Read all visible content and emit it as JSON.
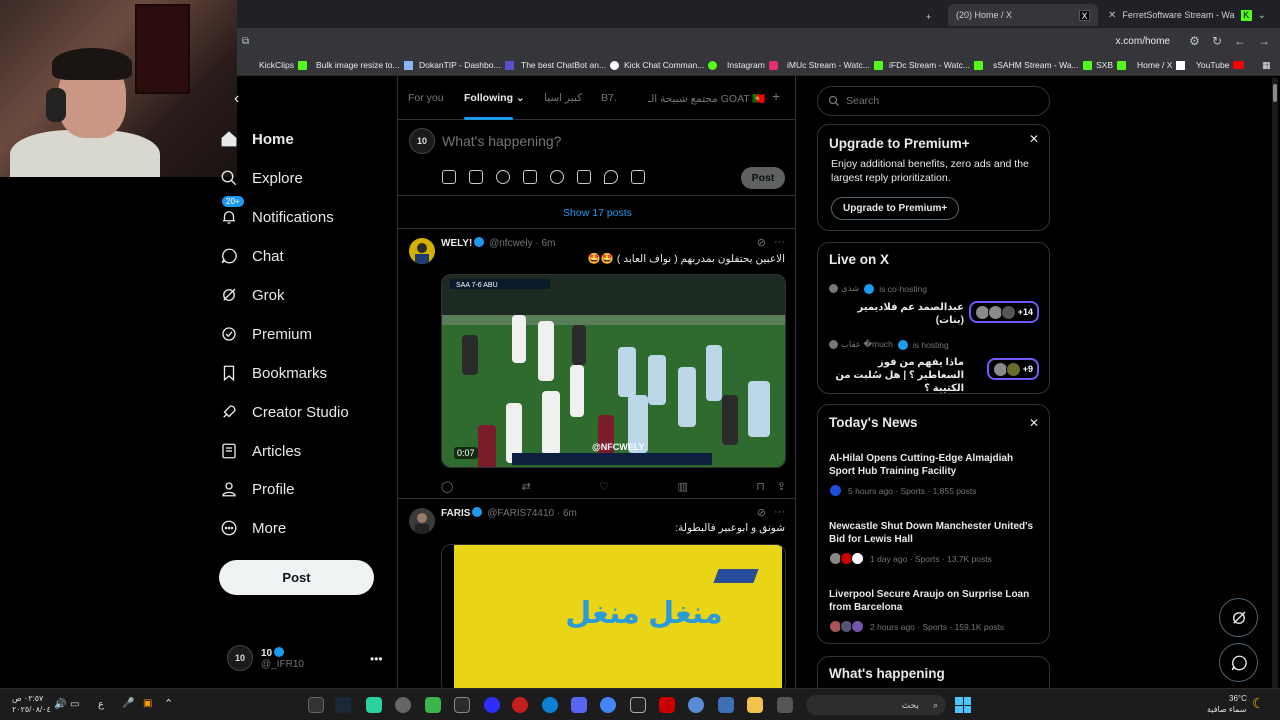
{
  "browser": {
    "tabs": [
      {
        "label": "(20) Home / X",
        "favicon": "X"
      },
      {
        "label": "FerretSoftware Stream - Wa",
        "favicon": "K"
      }
    ],
    "url": "x.com/home",
    "bookmarks": [
      {
        "label": "KickClips",
        "icon": "kick"
      },
      {
        "label": "Bulk image resize to...",
        "icon": "doc"
      },
      {
        "label": "DokanTIP - Dashbo...",
        "icon": "doc"
      },
      {
        "label": "The best ChatBot an...",
        "icon": "doc"
      },
      {
        "label": "Kick Chat Comman...",
        "icon": "doc"
      },
      {
        "label": "Instagram",
        "icon": "instagram"
      },
      {
        "label": "iMUc Stream - Watc...",
        "icon": "kick"
      },
      {
        "label": "iFDc Stream - Watc...",
        "icon": "kick"
      },
      {
        "label": "sSAHM Stream - Wa...",
        "icon": "kick"
      },
      {
        "label": "SXB",
        "icon": "kick"
      },
      {
        "label": "Home / X",
        "icon": "x"
      },
      {
        "label": "YouTube",
        "icon": "youtube"
      }
    ]
  },
  "nav": {
    "items": [
      {
        "label": "Home",
        "icon": "home-icon"
      },
      {
        "label": "Explore",
        "icon": "search-icon"
      },
      {
        "label": "Notifications",
        "icon": "bell-icon",
        "badge": "20+"
      },
      {
        "label": "Chat",
        "icon": "chat-icon"
      },
      {
        "label": "Grok",
        "icon": "grok-icon"
      },
      {
        "label": "Premium",
        "icon": "premium-icon"
      },
      {
        "label": "Bookmarks",
        "icon": "bookmark-icon"
      },
      {
        "label": "Creator Studio",
        "icon": "rocket-icon"
      },
      {
        "label": "Articles",
        "icon": "article-icon"
      },
      {
        "label": "Profile",
        "icon": "profile-icon"
      },
      {
        "label": "More",
        "icon": "more-icon"
      }
    ],
    "post_label": "Post",
    "account": {
      "name": "10",
      "handle": "@_IFR10",
      "avatar_text": "10"
    }
  },
  "feed": {
    "tabs": [
      "For you",
      "Following",
      "كبير اسيا",
      "B7.",
      "مجتمع شبيحة الـ GOAT 🇵🇹"
    ],
    "active_tab": "Following",
    "composer_placeholder": "What's happening?",
    "composer_post": "Post",
    "show_posts": "Show 17 posts",
    "tweets": [
      {
        "name": "WELY!",
        "handle": "@nfcwely",
        "time": "6m",
        "text": "الاعبين يحتفلون بمدربهم ( نواف العابد ) 🤩🤩",
        "video_time": "0:07",
        "scoreboard": "SAA 7-6 ABU",
        "watermark": "@NFCWELY"
      },
      {
        "name": "FARIS",
        "handle": "@FARIS74410",
        "time": "6m",
        "text": "شونق و ابوعبير فالبطولة:",
        "media_text": "منغل منغل"
      }
    ]
  },
  "sidebar": {
    "search_placeholder": "Search",
    "premium": {
      "title": "Upgrade to Premium+",
      "desc": "Enjoy additional benefits, zero ads and the largest reply prioritization.",
      "button": "Upgrade to Premium+"
    },
    "live": {
      "title": "Live on X",
      "items": [
        {
          "host": "شذى",
          "status": "is co-hosting",
          "title": "عبدالصمد عم فلاديمير (بنات)",
          "count": "+14"
        },
        {
          "host": "عقاب �much",
          "status": "is hosting",
          "title": "ماذا يفهم من فوز السعاطير ؟ | هل سُلبت من الكتيبة ؟",
          "count": "+9"
        }
      ]
    },
    "news": {
      "title": "Today's News",
      "items": [
        {
          "headline": "Al-Hilal Opens Cutting-Edge Almajdiah Sport Hub Training Facility",
          "meta": "5 hours ago · Sports · 1,855 posts"
        },
        {
          "headline": "Newcastle Shut Down Manchester United's Bid for Lewis Hall",
          "meta": "1 day ago · Sports · 13.7K posts"
        },
        {
          "headline": "Liverpool Secure Araujo on Surprise Loan from Barcelona",
          "meta": "2 hours ago · Sports · 159.1K posts"
        }
      ]
    },
    "whats_happening": "What's happening"
  },
  "taskbar": {
    "time": "٠٢:٥٧ ص",
    "date": "٢٠٢٥/٠٨/٠٤",
    "lang": "ع",
    "search_label": "بحث",
    "weather_temp": "36°C",
    "weather_desc": "سماء صافية"
  }
}
